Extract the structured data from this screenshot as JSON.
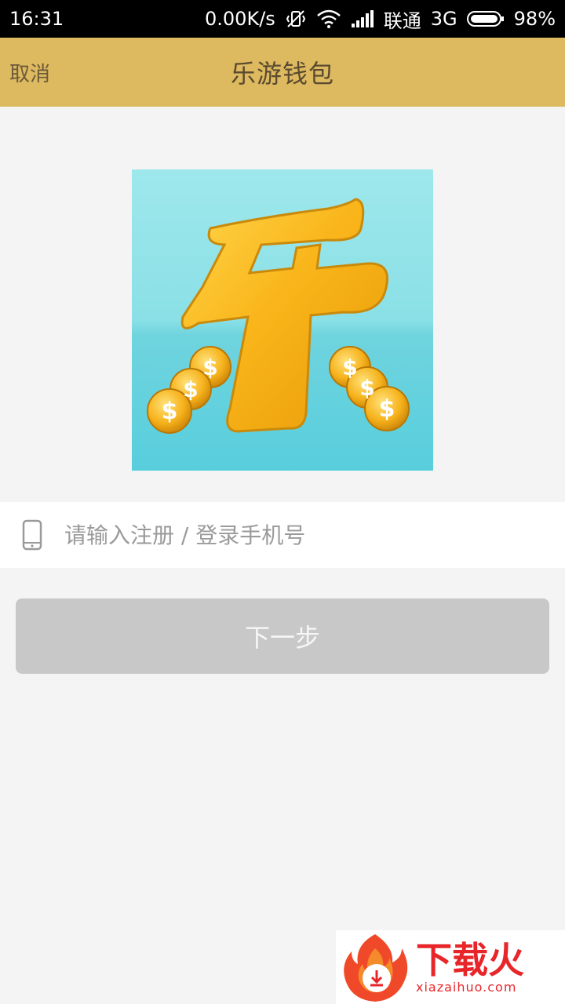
{
  "status_bar": {
    "time": "16:31",
    "speed": "0.00K/s",
    "carrier": "联通",
    "network": "3G",
    "battery": "98%"
  },
  "header": {
    "cancel_label": "取消",
    "title": "乐游钱包"
  },
  "logo": {
    "glyph": "乐",
    "coin_symbol": "$"
  },
  "phone_input": {
    "placeholder": "请输入注册 / 登录手机号",
    "value": ""
  },
  "next_button": {
    "label": "下一步"
  },
  "watermark": {
    "title": "下载火",
    "url": "xiazaihuo.com"
  },
  "colors": {
    "header_bg": "#ddb95f",
    "button_disabled": "#c8c8c8",
    "page_bg": "#f4f4f4",
    "watermark_red": "#e8262a"
  }
}
